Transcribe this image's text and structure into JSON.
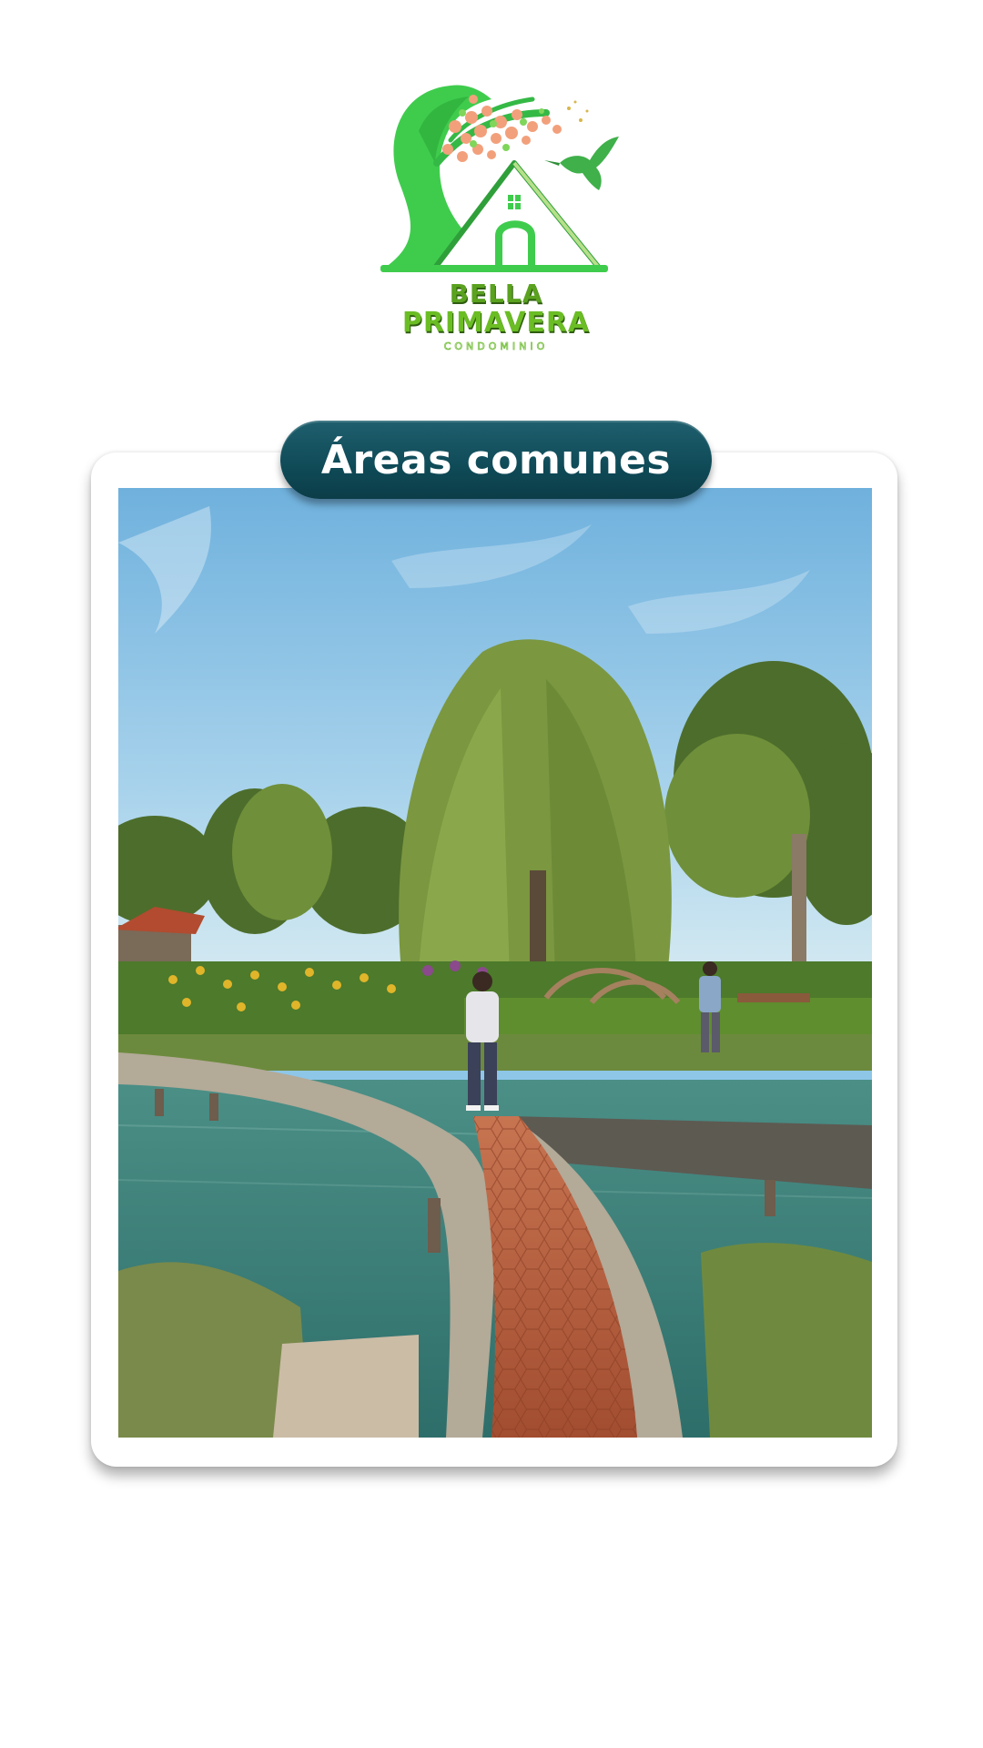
{
  "brand": {
    "name_line1": "BELLA",
    "name_line2": "PRIMAVERA",
    "tagline": "CONDOMINIO",
    "colors": {
      "primary_green": "#3fc14a",
      "accent_green": "#6bbd24",
      "blossom": "#f2a07b"
    },
    "icons": [
      "tree-icon",
      "house-icon",
      "hummingbird-icon"
    ]
  },
  "section": {
    "title": "Áreas comunes",
    "pill_color": "#0f4a57"
  },
  "image": {
    "subject": "garden-walkway-render",
    "colors": {
      "sky": "#8ec6e8",
      "foliage": "#6f8f3a",
      "water": "#3f7f73",
      "path": "#b85c3c"
    }
  }
}
